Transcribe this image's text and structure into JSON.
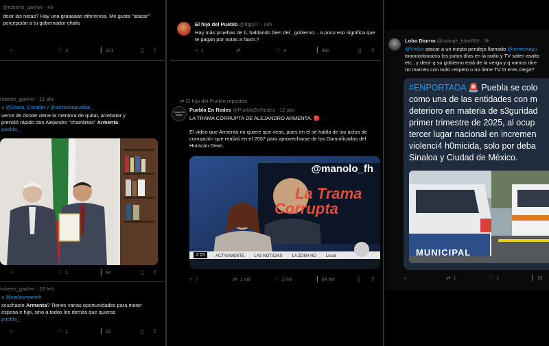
{
  "col1": {
    "t1": {
      "handle": "@roberto_gavher",
      "time": "· 4h",
      "text": "decir las netas? Hay una graaaaan diferencia. Me gusta \"atacar\" percepción a tu gobernador chafa",
      "likes": "3",
      "views": "101"
    },
    "t2": {
      "handle": "roberto_gavher",
      "time": "· 11 abr.",
      "reply_prefix": "a",
      "mention1": "@Diario_Cambio",
      "reply_mid": "y",
      "mention2": "@armentapuebla_",
      "text_a": "uerce de donde viene la mentora de quitar, arrebatar y",
      "text_b": "prendió rápido don Alejandro \"chambitas\"",
      "bold_name": "Armenta",
      "hashtag": "puebla_",
      "likes": "1",
      "views": "84"
    },
    "t3": {
      "handle": "roberto_gavher",
      "time": "· 26 feb.",
      "reply_prefix": "a",
      "mention": "@carlosmartish",
      "text_a": "scuchaste",
      "bold_name": "Armenta",
      "text_b": "? Tienes varias oportunidades para meter",
      "text_c": "esposa e hijo, sino a todos los demás que quieras",
      "hashtag": "puebla_",
      "likes": "1",
      "views": "15"
    }
  },
  "col2": {
    "t1": {
      "name": "El hijo del Pueblo",
      "handle": "@dgp27",
      "time": "· 19h",
      "text": "Hay más pruebas de ti, hablando bien del , gobierno... a poco eso significa que te pagan por notas a favor.?",
      "replies": "1",
      "likes": "4",
      "views": "492"
    },
    "t2": {
      "repost_label": "El hijo del Pueblo reposteó",
      "name": "Puebla En Redes",
      "handle": "@PueblaEnRedes",
      "time": "· 12 abr.",
      "avatar_text": "Puebla En Redes",
      "headline": "LA TRAMA CORRUPTA DE ALEJANDRO ARMENTA. 🔴",
      "body": "El video que Armenta no quiere que veas, pues en el sé habla de los actos de corrupción que realizó en el 2007 para aprovecharse de los Damnificados del Huracán Dean.",
      "video_handle": "@manolo_fh",
      "video_title1": "La Trama",
      "video_title2": "Corrupta",
      "video_time": "2:15",
      "video_ticker1": "ACTIVAMENTE",
      "video_ticker2": "LAS NOTICIAS",
      "video_ticker3": "LA ZONA HD",
      "video_ticker4": "Local",
      "replies": "7",
      "reposts": "1 mil",
      "likes": "2 mil",
      "views": "64 mil"
    }
  },
  "col3": {
    "t1": {
      "name": "Lobo Diurno",
      "handle": "@salvaje_lobo666",
      "time": "· 9h",
      "mention1": "@Viriloz",
      "text_a": "atacar a un inepto pendejo llamado",
      "mention2": "@armentapu",
      "text_b": "tooooodooooss los putos días en la radio y TV salen asalto",
      "text_c": "etc.. y decir q su gobierno está de la verga y q vamos dire",
      "text_d": "no mames con todo respeto o no tiene TV O eres ciega?"
    },
    "card": {
      "hashtag": "#ENPORTADA",
      "line1_rest": "🚨 Puebla se colo",
      "line2": "como una de las entidades con m",
      "line3": "deterioro en materia de s3guridad",
      "line4": "primer trimestre de 2025, al ocup",
      "line5": "tercer lugar nacional en incremen",
      "line6": "violenci4 h0micida, solo por deba",
      "line7": "Sinaloa y Ciudad de México.",
      "photo_label": "MUNICIPAL"
    },
    "actions": {
      "reposts": "1",
      "likes": "1",
      "views": "15"
    }
  },
  "colors": {
    "background": "#000000",
    "text": "#e7e9ea",
    "muted": "#71767b",
    "link": "#1d9bf0",
    "card_bg": "#1e2c3d"
  }
}
